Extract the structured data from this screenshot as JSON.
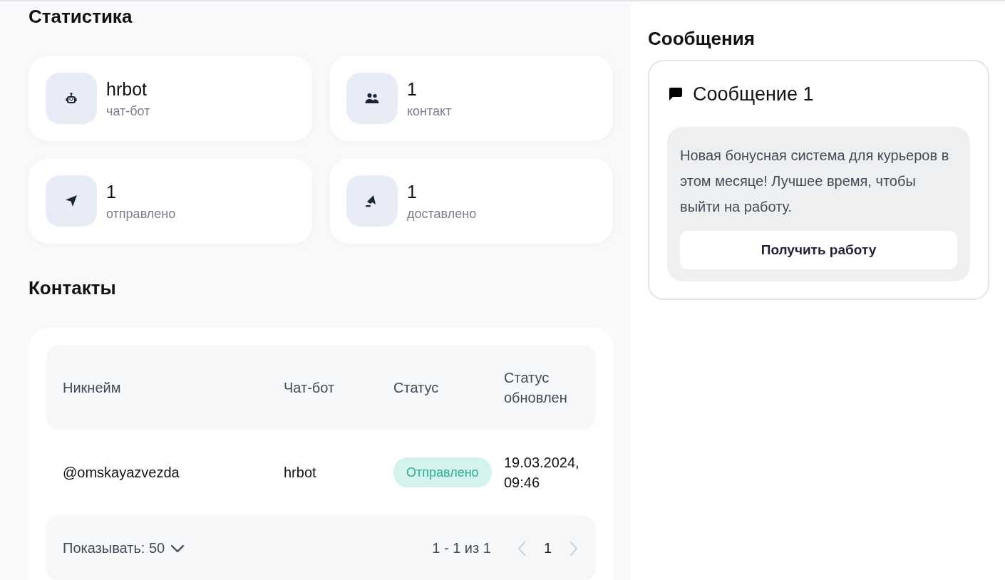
{
  "statistics": {
    "title": "Статистика",
    "cards": [
      {
        "kind": "robot",
        "value": "hrbot",
        "label": "чат-бот"
      },
      {
        "kind": "people",
        "value": "1",
        "label": "контакт"
      },
      {
        "kind": "send",
        "value": "1",
        "label": "отправлено"
      },
      {
        "kind": "delivered",
        "value": "1",
        "label": "доставлено"
      }
    ]
  },
  "contacts": {
    "title": "Контакты",
    "columns": [
      "Никнейм",
      "Чат-бот",
      "Статус",
      "Статус обновлен"
    ],
    "rows": [
      {
        "nickname": "@omskayazvezda",
        "bot": "hrbot",
        "status": {
          "text": "Отправлено",
          "kind": "sent"
        },
        "updated": "19.03.2024, 09:46"
      }
    ],
    "pagination": {
      "page_size": "Показывать: 50",
      "range": "1 - 1 из 1",
      "page": "1",
      "prev": {
        "disabled": true
      },
      "next": {
        "disabled": true
      }
    }
  },
  "messages": {
    "title": "Сообщения",
    "items": [
      {
        "title": "Сообщение 1",
        "text": "Новая бонусная система для курьеров в этом месяце! Лучшее время, чтобы выйти на работу.",
        "button": "Получить работу"
      }
    ]
  }
}
